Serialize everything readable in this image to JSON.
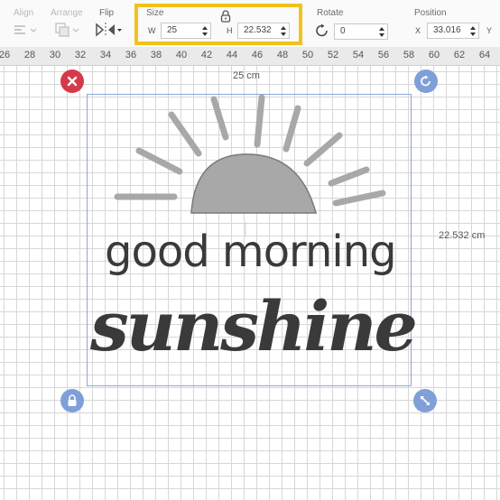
{
  "toolbar": {
    "align_label": "Align",
    "arrange_label": "Arrange",
    "flip_label": "Flip",
    "size_label": "Size",
    "width_label": "W",
    "width_value": "25",
    "height_label": "H",
    "height_value": "22.532",
    "rotate_label": "Rotate",
    "rotate_value": "0",
    "position_label": "Position",
    "x_label": "X",
    "x_value": "33.016",
    "y_label": "Y",
    "icons": [
      "align-icon",
      "arrange-icon",
      "flip-icon",
      "lock-icon",
      "rotate-icon"
    ],
    "highlight_color": "#f2c21b"
  },
  "ruler": {
    "ticks": [
      "26",
      "28",
      "30",
      "32",
      "34",
      "36",
      "38",
      "40",
      "42",
      "44",
      "46",
      "48",
      "50",
      "52",
      "54",
      "56",
      "58",
      "60",
      "62",
      "64"
    ]
  },
  "canvas": {
    "width_dimension": "25 cm",
    "height_dimension": "22.532 cm",
    "handles": {
      "delete": "close-icon",
      "rotate": "rotate-icon",
      "lock": "lock-icon",
      "resize": "resize-icon"
    },
    "design": {
      "line1": "good morning",
      "line2": "sunshine",
      "sun_color": "#a8a8a8",
      "text_color": "#3a3a3a"
    }
  }
}
